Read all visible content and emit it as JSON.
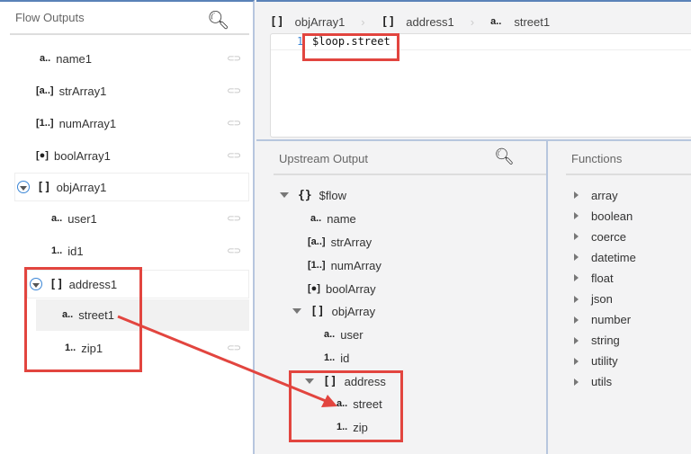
{
  "left": {
    "title": "Flow Outputs",
    "items": [
      {
        "icon": "a..",
        "label": "name1"
      },
      {
        "icon": "[a..]",
        "label": "strArray1"
      },
      {
        "icon": "[1..]",
        "label": "numArray1"
      },
      {
        "icon": "[bool]",
        "label": "boolArray1"
      },
      {
        "icon": "[ ]",
        "label": "objArray1"
      },
      {
        "icon": "a..",
        "label": "user1"
      },
      {
        "icon": "1..",
        "label": "id1"
      },
      {
        "icon": "[ ]",
        "label": "address1"
      },
      {
        "icon": "a..",
        "label": "street1"
      },
      {
        "icon": "1..",
        "label": "zip1"
      }
    ]
  },
  "breadcrumb": [
    {
      "icon": "[ ]",
      "label": "objArray1"
    },
    {
      "icon": "[ ]",
      "label": "address1"
    },
    {
      "icon": "a..",
      "label": "street1"
    }
  ],
  "editor": {
    "line": "1",
    "code": "$loop.street"
  },
  "upstream": {
    "title": "Upstream Output",
    "items": [
      {
        "icon": "{}",
        "label": "$flow"
      },
      {
        "icon": "a..",
        "label": "name"
      },
      {
        "icon": "[a..]",
        "label": "strArray"
      },
      {
        "icon": "[1..]",
        "label": "numArray"
      },
      {
        "icon": "[bool]",
        "label": "boolArray"
      },
      {
        "icon": "[ ]",
        "label": "objArray"
      },
      {
        "icon": "a..",
        "label": "user"
      },
      {
        "icon": "1..",
        "label": "id"
      },
      {
        "icon": "[ ]",
        "label": "address"
      },
      {
        "icon": "a..",
        "label": "street"
      },
      {
        "icon": "1..",
        "label": "zip"
      }
    ]
  },
  "functions": {
    "title": "Functions",
    "items": [
      "array",
      "boolean",
      "coerce",
      "datetime",
      "float",
      "json",
      "number",
      "string",
      "utility",
      "utils"
    ]
  }
}
